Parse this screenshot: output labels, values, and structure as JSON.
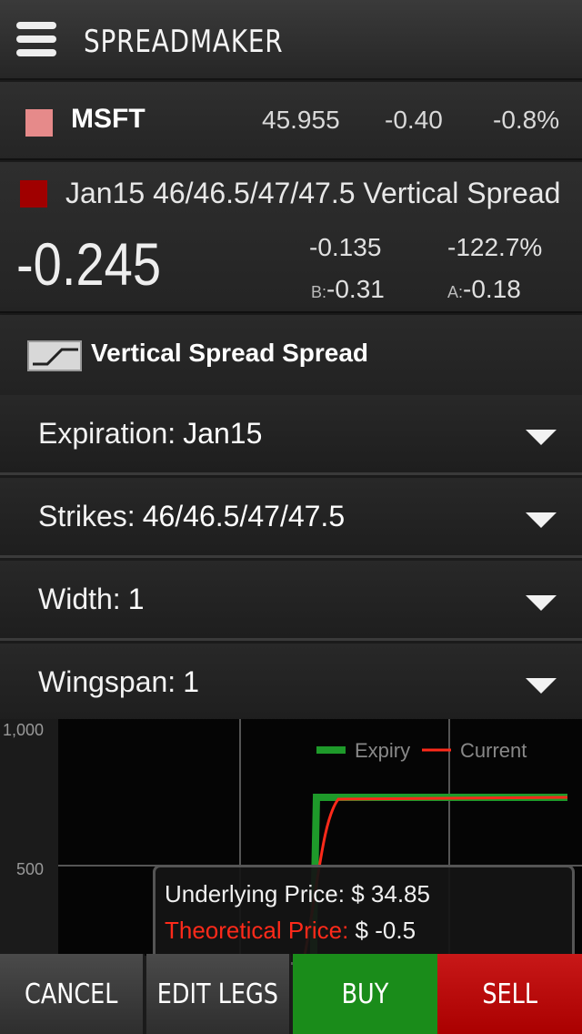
{
  "header": {
    "title": "SPREADMAKER"
  },
  "ticker": {
    "symbol": "MSFT",
    "price": "45.955",
    "change": "-0.40",
    "change_pct": "-0.8%",
    "color": "#e68a8a"
  },
  "spread": {
    "name": "Jan15 46/46.5/47/47.5 Vertical Spread",
    "color": "#a00000",
    "mark": "-0.245",
    "change": "-0.135",
    "change_pct": "-122.7%",
    "bid_label": "B:",
    "bid": "-0.31",
    "ask_label": "A:",
    "ask": "-0.18"
  },
  "strategy": {
    "label": "Vertical Spread Spread",
    "icon": "spread-graph-icon"
  },
  "fields": [
    {
      "label": "Expiration:",
      "value": "Jan15"
    },
    {
      "label": "Strikes:",
      "value": "46/46.5/47/47.5"
    },
    {
      "label": "Width:",
      "value": "1"
    },
    {
      "label": "Wingspan:",
      "value": "1"
    }
  ],
  "chart_data": {
    "type": "line",
    "y_ticks": [
      "1,000",
      "500"
    ],
    "ylim": [
      0,
      1000
    ],
    "legend": [
      "Expiry",
      "Current"
    ],
    "series_colors": {
      "Expiry": "#1e9a2a",
      "Current": "#ff2a1a"
    },
    "grid": true
  },
  "tooltip": {
    "underlying_label": "Underlying Price:",
    "underlying_value": "$ 34.85",
    "theoretical_label": "Theoretical Price:",
    "theoretical_value": "$ -0.5"
  },
  "actions": {
    "cancel": "CANCEL",
    "edit_legs": "EDIT LEGS",
    "buy": "BUY",
    "sell": "SELL"
  }
}
